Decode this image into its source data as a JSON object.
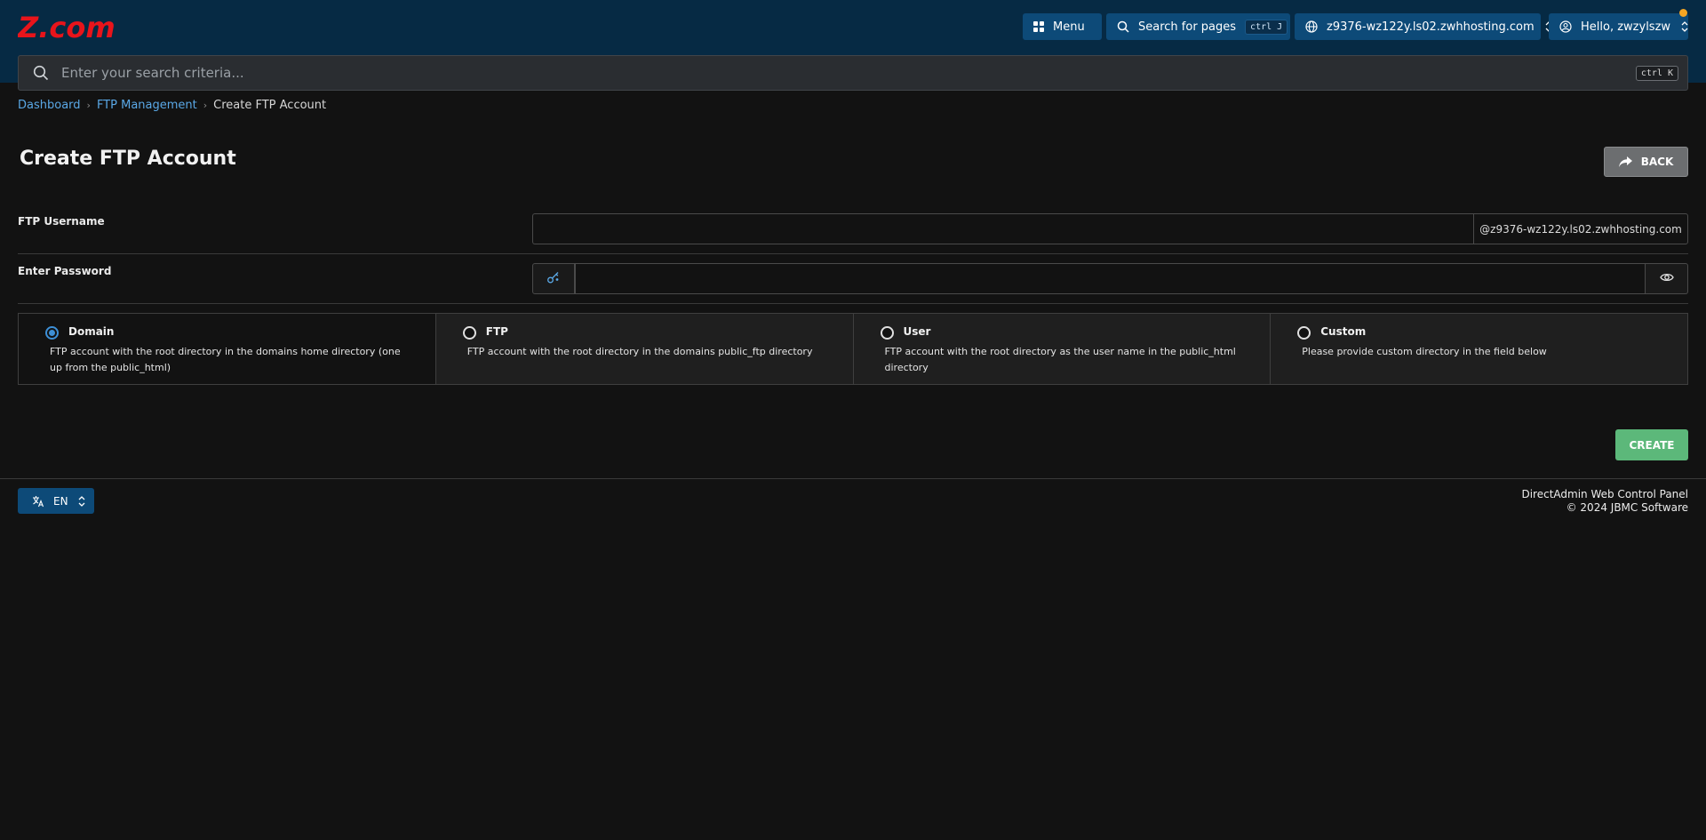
{
  "header": {
    "logo_text": "Z.com",
    "menu_label": "Menu",
    "search_pages_label": "Search for pages",
    "search_pages_shortcut": "ctrl J",
    "domain_select": "z9376-wz122y.ls02.zwhhosting.com",
    "user_greeting": "Hello, zwzylszw",
    "notification_color": "#f5a623"
  },
  "search": {
    "placeholder": "Enter your search criteria...",
    "shortcut": "ctrl K"
  },
  "breadcrumb": {
    "items": [
      "Dashboard",
      "FTP Management"
    ],
    "current": "Create FTP Account"
  },
  "page": {
    "title": "Create FTP Account",
    "back_label": "BACK"
  },
  "form": {
    "username_label": "FTP Username",
    "username_value": "",
    "username_suffix": "@z9376-wz122y.ls02.zwhhosting.com",
    "password_label": "Enter Password",
    "password_value": ""
  },
  "options": [
    {
      "name": "Domain",
      "desc": "FTP account with the root directory in the domains home directory (one up from the public_html)",
      "selected": true
    },
    {
      "name": "FTP",
      "desc": "FTP account with the root directory in the domains public_ftp directory",
      "selected": false
    },
    {
      "name": "User",
      "desc": "FTP account with the root directory as the user name in the public_html directory",
      "selected": false
    },
    {
      "name": "Custom",
      "desc": "Please provide custom directory in the field below",
      "selected": false
    }
  ],
  "actions": {
    "create_label": "CREATE"
  },
  "footer": {
    "language": "EN",
    "product": "DirectAdmin Web Control Panel",
    "copyright": "© 2024 JBMC Software"
  },
  "colors": {
    "header_bg": "#062a44",
    "accent_blue": "#0d4a78",
    "create_green": "#5cb87a",
    "logo_red": "#e8141b"
  }
}
